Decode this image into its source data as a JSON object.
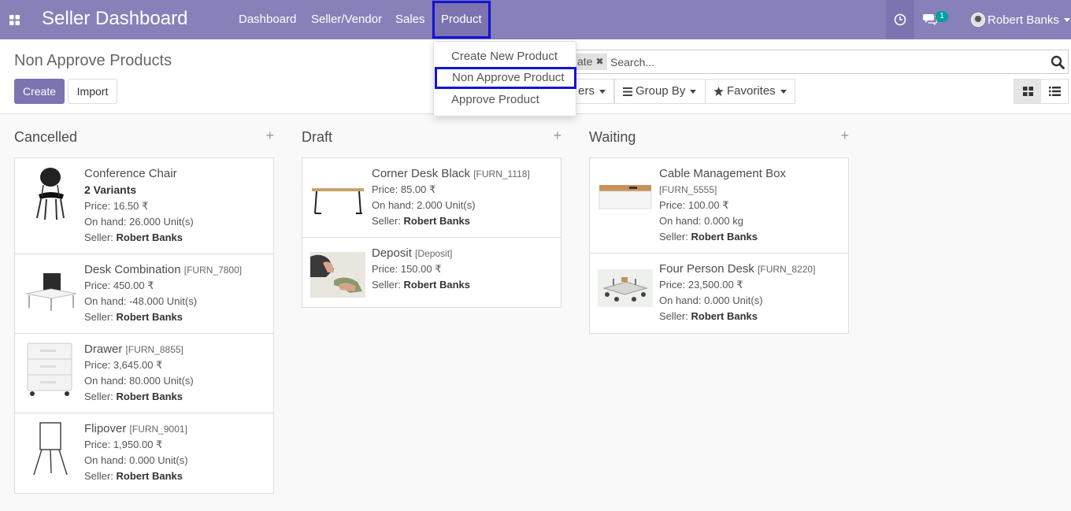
{
  "navbar": {
    "brand": "Seller Dashboard",
    "menu": [
      "Dashboard",
      "Seller/Vendor",
      "Sales",
      "Product"
    ],
    "chat_count": "1",
    "user_name": "Robert Banks",
    "bg_color": "#8881b9",
    "highlight_color": "#1414d6"
  },
  "control_panel": {
    "title": "Non Approve Products",
    "create_label": "Create",
    "import_label": "Import",
    "facet_label": "ate",
    "search_placeholder": "Search...",
    "filters_label": "ers",
    "group_by_label": "Group By",
    "favorites_label": "Favorites"
  },
  "product_menu": {
    "items": [
      "Create New Product",
      "Non Approve Product",
      "Approve Product"
    ]
  },
  "columns": [
    {
      "title": "Cancelled",
      "cards": [
        {
          "name": "Conference Chair",
          "ref": "",
          "variants": "2 Variants",
          "price": "Price: 16.50 ₹",
          "onhand": "On hand: 26.000 Unit(s)",
          "seller_label": "Seller:",
          "seller": "Robert Banks",
          "image": "chair"
        },
        {
          "name": "Desk Combination",
          "ref": "[FURN_7800]",
          "variants": "",
          "price": "Price: 450.00 ₹",
          "onhand": "On hand: -48.000 Unit(s)",
          "seller_label": "Seller:",
          "seller": "Robert Banks",
          "image": "desk-combination"
        },
        {
          "name": "Drawer",
          "ref": "[FURN_8855]",
          "variants": "",
          "price": "Price: 3,645.00 ₹",
          "onhand": "On hand: 80.000 Unit(s)",
          "seller_label": "Seller:",
          "seller": "Robert Banks",
          "image": "drawer"
        },
        {
          "name": "Flipover",
          "ref": "[FURN_9001]",
          "variants": "",
          "price": "Price: 1,950.00 ₹",
          "onhand": "On hand: 0.000 Unit(s)",
          "seller_label": "Seller:",
          "seller": "Robert Banks",
          "image": "flipover"
        }
      ]
    },
    {
      "title": "Draft",
      "cards": [
        {
          "name": "Corner Desk Black",
          "ref": "[FURN_1118]",
          "variants": "",
          "price": "Price: 85.00 ₹",
          "onhand": "On hand: 2.000 Unit(s)",
          "seller_label": "Seller:",
          "seller": "Robert Banks",
          "image": "corner-desk"
        },
        {
          "name": "Deposit",
          "ref": "[Deposit]",
          "variants": "",
          "price": "Price: 150.00 ₹",
          "onhand": "",
          "seller_label": "Seller:",
          "seller": "Robert Banks",
          "image": "deposit"
        }
      ]
    },
    {
      "title": "Waiting",
      "cards": [
        {
          "name": "Cable Management Box",
          "ref": "[FURN_5555]",
          "variants": "",
          "price": "Price: 100.00 ₹",
          "onhand": "On hand: 0.000 kg",
          "seller_label": "Seller:",
          "seller": "Robert Banks",
          "image": "cable-box"
        },
        {
          "name": "Four Person Desk",
          "ref": "[FURN_8220]",
          "variants": "",
          "price": "Price: 23,500.00 ₹",
          "onhand": "On hand: 0.000 Unit(s)",
          "seller_label": "Seller:",
          "seller": "Robert Banks",
          "image": "four-person-desk"
        }
      ]
    }
  ]
}
